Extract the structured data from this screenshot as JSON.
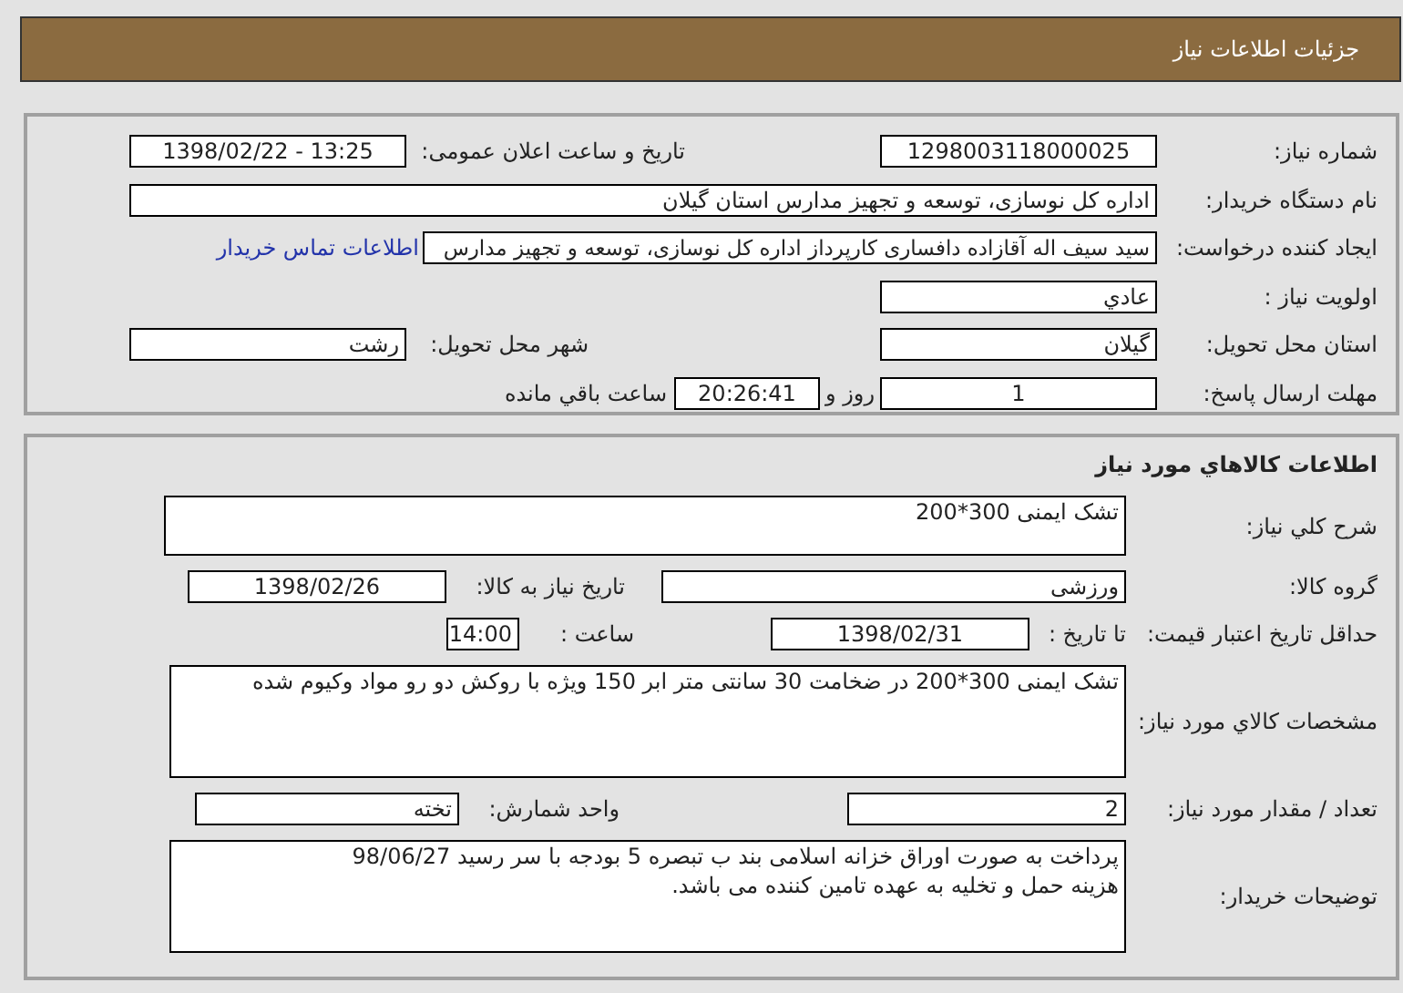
{
  "header": {
    "title": "جزئیات اطلاعات نیاز"
  },
  "need_info": {
    "need_number": {
      "label": "شماره نیاز:",
      "value": "1298003118000025"
    },
    "announce": {
      "label": "تاریخ و ساعت اعلان عمومی:",
      "value": "1398/02/22 - 13:25"
    },
    "buyer_org": {
      "label": "نام دستگاه خریدار:",
      "value": "اداره کل نوسازی، توسعه و تجهیز مدارس استان گیلان"
    },
    "requester": {
      "label": "ایجاد کننده درخواست:",
      "value": "سید سیف اله آقازاده دافساری کارپرداز اداره کل نوسازی، توسعه و تجهیز مدارس",
      "link": "اطلاعات تماس خریدار"
    },
    "priority": {
      "label": "اولویت نیاز :",
      "value": "عادي"
    },
    "province": {
      "label": "استان محل تحویل:",
      "value": "گیلان"
    },
    "city": {
      "label": "شهر محل تحویل:",
      "value": "رشت"
    },
    "deadline": {
      "label": "مهلت ارسال پاسخ:",
      "days": "1",
      "days_unit": "روز و",
      "time": "20:26:41",
      "time_suffix": "ساعت باقي مانده"
    }
  },
  "goods": {
    "title": "اطلاعات کالاهاي مورد نیاز",
    "summary": {
      "label": "شرح کلي نیاز:",
      "value": "تشک ایمنی 300*200"
    },
    "group": {
      "label": "گروه کالا:",
      "value": "ورزشی"
    },
    "need_date": {
      "label": "تاریخ نیاز به کالا:",
      "value": "1398/02/26"
    },
    "price_validity": {
      "label": "حداقل تاریخ اعتبار قیمت:",
      "date_label": "تا تاریخ :",
      "date": "1398/02/31",
      "time_label": "ساعت :",
      "time": "14:00"
    },
    "specs": {
      "label": "مشخصات کالاي مورد نیاز:",
      "value": "تشک ایمنی 300*200 در ضخامت 30 سانتی متر ابر 150 ویژه با روکش دو رو مواد وکیوم شده"
    },
    "quantity": {
      "label": "تعداد / مقدار مورد نیاز:",
      "value": "2"
    },
    "unit": {
      "label": "واحد شمارش:",
      "value": "تخته"
    },
    "buyer_notes": {
      "label": "توضیحات خریدار:",
      "lines": [
        "پرداخت به صورت اوراق خزانه اسلامی بند ب تبصره 5 بودجه با سر رسید 98/06/27",
        "هزینه حمل و تخلیه به عهده تامین کننده می باشد."
      ]
    }
  }
}
